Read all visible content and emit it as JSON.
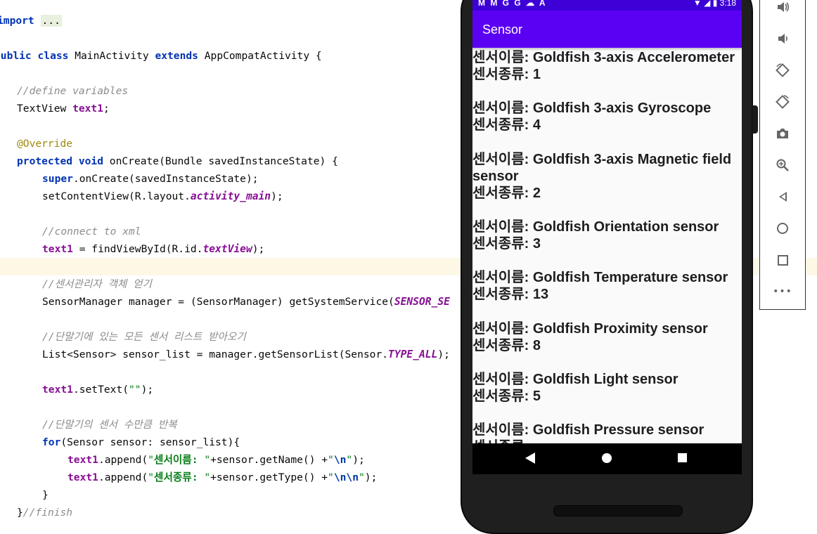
{
  "editor": {
    "lines": [
      "import ...",
      "public class MainActivity extends AppCompatActivity {",
      "//define variables",
      "TextView text1;",
      "@Override",
      "protected void onCreate(Bundle savedInstanceState) {",
      "super.onCreate(savedInstanceState);",
      "setContentView(R.layout.activity_main);",
      "//connect to xml",
      "text1 = findViewById(R.id.textView);",
      "//센서관리자 객체 얻기",
      "SensorManager manager = (SensorManager) getSystemService(SENSOR_SE",
      "//단말기에 있는 모든 센서 리스트 받아오기",
      "List<Sensor> sensor_list = manager.getSensorList(Sensor.TYPE_ALL);",
      "text1.setText(\"\");",
      "//단말기의 센서 수만큼 반복",
      "for(Sensor sensor: sensor_list){",
      "text1.append(\"센서이름: \"+sensor.getName() +\"\\n\");",
      "text1.append(\"센서종류: \"+sensor.getType() +\"\\n\\n\");",
      "}",
      "}//finish"
    ]
  },
  "phone": {
    "status_icons": "M M G G ☁ A",
    "time": "3:18",
    "app_title": "Sensor",
    "name_label": "센서이름:",
    "type_label": "센서종류:",
    "sensors": [
      {
        "name": "Goldfish 3-axis Accelerometer",
        "type": "1"
      },
      {
        "name": "Goldfish 3-axis Gyroscope",
        "type": "4"
      },
      {
        "name": "Goldfish 3-axis Magnetic field sensor",
        "type": "2"
      },
      {
        "name": "Goldfish Orientation sensor",
        "type": "3"
      },
      {
        "name": "Goldfish Temperature sensor",
        "type": "13"
      },
      {
        "name": "Goldfish Proximity sensor",
        "type": "8"
      },
      {
        "name": "Goldfish Light sensor",
        "type": "5"
      },
      {
        "name": "Goldfish Pressure sensor",
        "type": ""
      }
    ]
  },
  "toolbar": {
    "buttons": [
      "volume-up-icon",
      "volume-down-icon",
      "rotate-left-icon",
      "rotate-right-icon",
      "camera-icon",
      "zoom-icon",
      "back-icon",
      "home-icon",
      "overview-icon",
      "more-icon"
    ]
  }
}
